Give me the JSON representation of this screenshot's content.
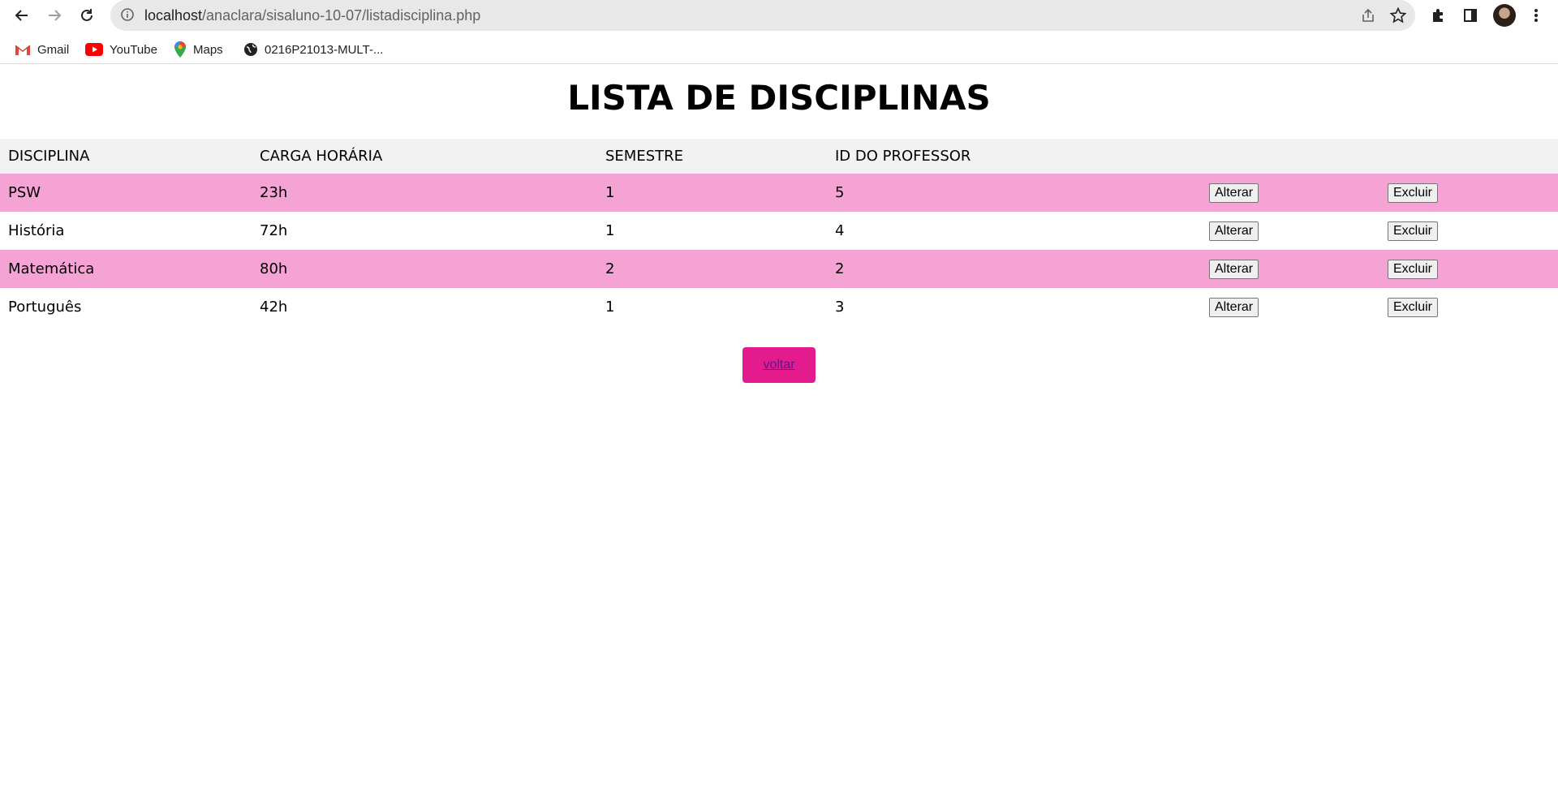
{
  "browser": {
    "url_host": "localhost",
    "url_path": "/anaclara/sisaluno-10-07/listadisciplina.php",
    "bookmarks": [
      {
        "label": "Gmail",
        "icon": "gmail-icon"
      },
      {
        "label": "YouTube",
        "icon": "youtube-icon"
      },
      {
        "label": "Maps",
        "icon": "maps-icon"
      },
      {
        "label": "0216P21013-MULT-...",
        "icon": "globe-icon"
      }
    ]
  },
  "page": {
    "title": "LISTA DE DISCIPLINAS",
    "headers": [
      "DISCIPLINA",
      "CARGA HORÁRIA",
      "SEMESTRE",
      "ID DO PROFESSOR",
      "",
      ""
    ],
    "rows": [
      {
        "disciplina": "PSW",
        "carga": "23h",
        "semestre": "1",
        "professor": "5",
        "highlight": true
      },
      {
        "disciplina": "História",
        "carga": "72h",
        "semestre": "1",
        "professor": "4",
        "highlight": false
      },
      {
        "disciplina": "Matemática",
        "carga": "80h",
        "semestre": "2",
        "professor": "2",
        "highlight": true
      },
      {
        "disciplina": "Português",
        "carga": "42h",
        "semestre": "1",
        "professor": "3",
        "highlight": false
      }
    ],
    "alterar_label": "Alterar",
    "excluir_label": "Excluir",
    "voltar_label": "voltar"
  },
  "colors": {
    "row_highlight": "#f5a3d4",
    "header_bg": "#f2f2f2",
    "voltar_bg": "#e31b8c"
  }
}
